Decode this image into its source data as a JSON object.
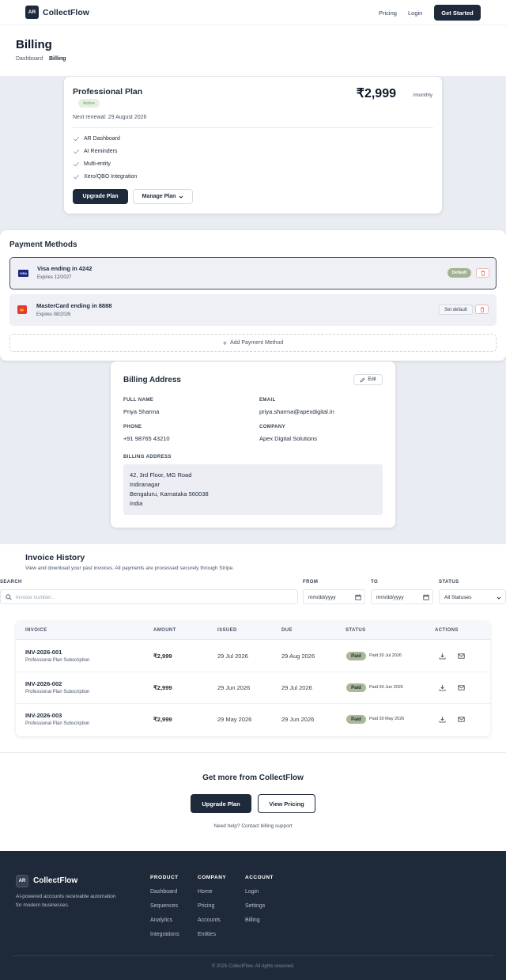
{
  "header": {
    "logo_initials": "AR",
    "brand": "CollectFlow",
    "nav": [
      "Pricing",
      "Login"
    ],
    "cta": "Get Started"
  },
  "page": {
    "title": "Billing",
    "breadcrumb": [
      "Dashboard",
      "Billing"
    ]
  },
  "plan": {
    "name": "Professional Plan",
    "status": "Active",
    "price": "₹2,999",
    "period": "/monthly",
    "renewal": "Next renewal: 29 August 2026",
    "features": [
      "AR Dashboard",
      "AI Reminders",
      "Multi-entity",
      "Xero/QBO Integration"
    ],
    "upgrade_label": "Upgrade Plan",
    "manage_label": "Manage Plan"
  },
  "payment_methods": {
    "title": "Payment Methods",
    "cards": [
      {
        "name": "Visa ending in 4242",
        "expires": "Expires 12/2027",
        "badge": "Default",
        "brand_short": "VISA"
      },
      {
        "name": "MasterCard ending in 8888",
        "expires": "Expires 08/2026",
        "action": "Set default"
      }
    ],
    "add_label": "Add Payment Method"
  },
  "billing_address": {
    "title": "Billing Address",
    "edit_label": "Edit",
    "full_name_label": "FULL NAME",
    "full_name": "Priya Sharma",
    "email_label": "EMAIL",
    "email": "priya.sharma@apexdigital.in",
    "phone_label": "PHONE",
    "phone": "+91 98765 43210",
    "company_label": "COMPANY",
    "company": "Apex Digital Solutions",
    "address_label": "BILLING ADDRESS",
    "address_lines": [
      "42, 3rd Floor, MG Road",
      "Indiranagar",
      "Bengaluru, Karnataka 560038",
      "India"
    ]
  },
  "invoices": {
    "title": "Invoice History",
    "subtitle": "View and download your past invoices. All payments are processed securely through Stripe.",
    "filters": {
      "search_label": "SEARCH",
      "search_placeholder": "Invoice number...",
      "from_label": "FROM",
      "from_value": "mm/dd/yyyy",
      "to_label": "TO",
      "to_value": "mm/dd/yyyy",
      "status_label": "STATUS",
      "status_value": "All Statuses"
    },
    "columns": [
      "INVOICE",
      "AMOUNT",
      "ISSUED",
      "DUE",
      "STATUS",
      "ACTIONS"
    ],
    "rows": [
      {
        "id": "INV-2026-001",
        "desc": "Professional Plan Subscription",
        "amount": "₹2,999",
        "issued": "29 Jul 2026",
        "due": "29 Aug 2026",
        "status": "Paid",
        "paid_on": "Paid 30 Jul 2026"
      },
      {
        "id": "INV-2026-002",
        "desc": "Professional Plan Subscription",
        "amount": "₹2,999",
        "issued": "29 Jun 2026",
        "due": "29 Jul 2026",
        "status": "Paid",
        "paid_on": "Paid 30 Jun 2026"
      },
      {
        "id": "INV-2026-003",
        "desc": "Professional Plan Subscription",
        "amount": "₹2,999",
        "issued": "29 May 2026",
        "due": "29 Jun 2026",
        "status": "Paid",
        "paid_on": "Paid 30 May 2026"
      }
    ]
  },
  "cta": {
    "title": "Get more from CollectFlow",
    "primary": "Upgrade Plan",
    "secondary": "View Pricing",
    "help": "Need help? Contact billing support"
  },
  "footer": {
    "brand": "CollectFlow",
    "logo_initials": "AR",
    "tagline_lines": [
      "AI-powered accounts receivable automation",
      "for modern businesses."
    ],
    "columns": [
      {
        "title": "PRODUCT",
        "links": [
          "Dashboard",
          "Sequences",
          "Analytics",
          "Integrations"
        ]
      },
      {
        "title": "COMPANY",
        "links": [
          "Home",
          "Pricing",
          "Accounts",
          "Entities"
        ]
      },
      {
        "title": "ACCOUNT",
        "links": [
          "Login",
          "Settings",
          "Billing"
        ]
      }
    ],
    "copyright": "© 2025 CollectFlow. All rights reserved."
  },
  "colors": {
    "primary": "#1e293b",
    "page_band": "#e9ecf2",
    "paid_badge": "#a7b99a",
    "default_badge": "#a3b394",
    "footer_bg": "#1e2939"
  }
}
